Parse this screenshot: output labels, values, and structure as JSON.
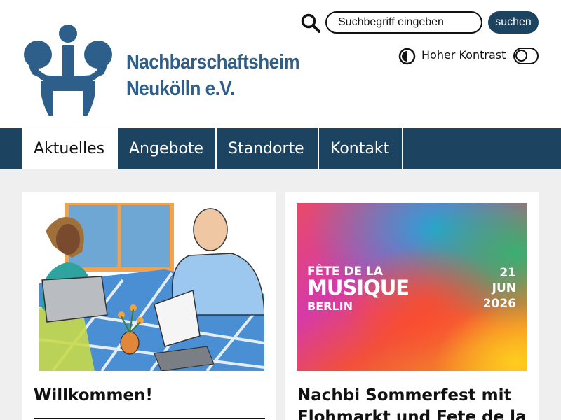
{
  "site": {
    "name_line1": "Nachbarschaftsheim",
    "name_line2": "Neukölln e.V.",
    "brand_color": "#2e5f8a"
  },
  "search": {
    "placeholder": "Suchbegriff eingeben",
    "button_label": "suchen",
    "icon": "search-icon"
  },
  "contrast": {
    "label": "Hoher Kontrast",
    "icon": "contrast-icon",
    "enabled": false
  },
  "nav": {
    "color": "#1c4360",
    "items": [
      {
        "label": "Aktuelles",
        "active": true
      },
      {
        "label": "Angebote",
        "active": false
      },
      {
        "label": "Standorte",
        "active": false
      },
      {
        "label": "Kontakt",
        "active": false
      }
    ]
  },
  "cards": [
    {
      "title": "Willkommen!",
      "image": "illustration-two-people-at-table"
    },
    {
      "title": "Nachbi Sommerfest mit Flohmarkt und Fete de la",
      "image": {
        "line1": "FÊTE DE LA",
        "line2": "MUSIQUE",
        "line3": "BERLIN",
        "date_day": "21",
        "date_month": "JUN",
        "date_year": "2026"
      }
    }
  ]
}
